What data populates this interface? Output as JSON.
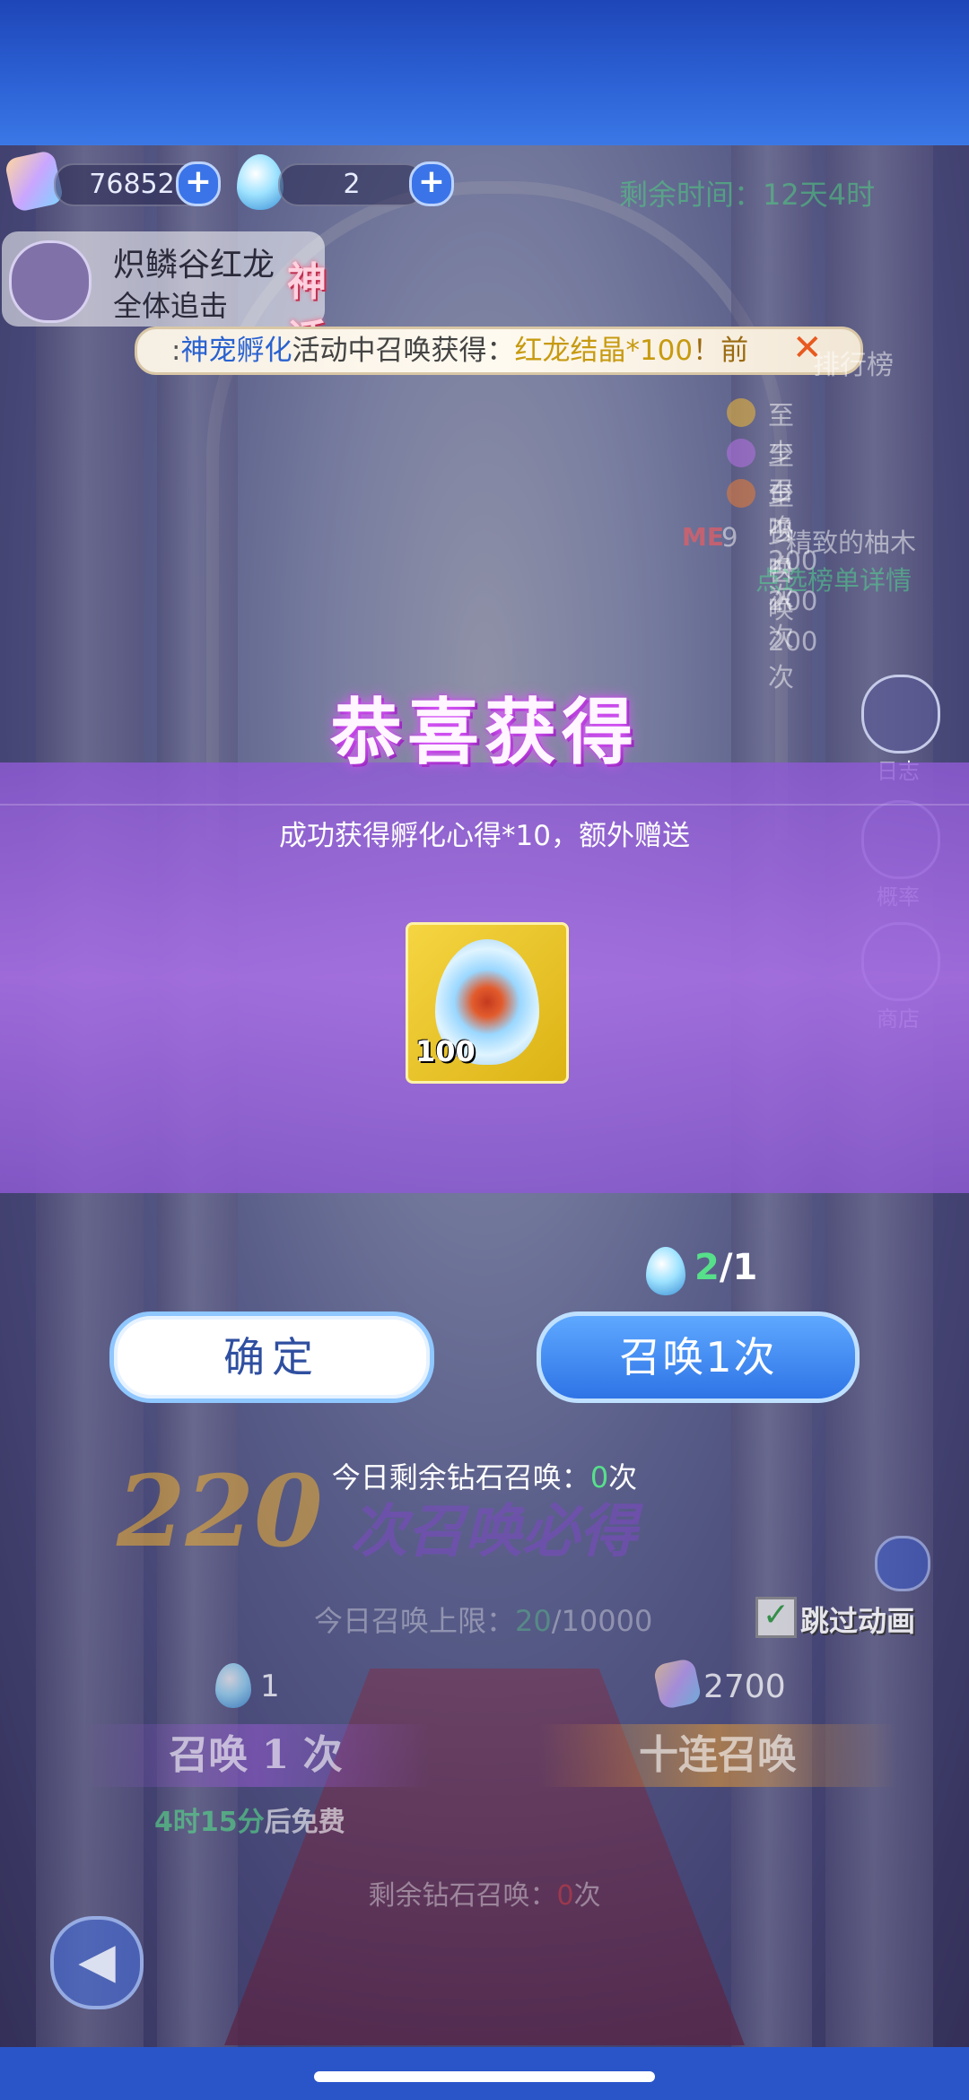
{
  "currency": {
    "gems": "76852",
    "eggs": "2",
    "plus": "+"
  },
  "event": {
    "remaining_time": "剩余时间：12天4时"
  },
  "boss": {
    "name": "炽鳞谷红龙",
    "subtitle": "全体追击",
    "badge": "神话"
  },
  "marquee": {
    "prefix": ":",
    "activity": "神宠孵化",
    "middle": "活动中召唤获得：",
    "item": "红龙结晶*100",
    "suffix": "！前"
  },
  "ranking": {
    "title": "排行榜",
    "entries": [
      {
        "rank": "1",
        "text": "至少召唤200次",
        "color": "#e8b43a"
      },
      {
        "rank": "2",
        "text": "至少召唤200次",
        "color": "#b070e0"
      },
      {
        "rank": "3",
        "text": "至少召唤200次",
        "color": "#e07a3a"
      }
    ],
    "me_label": "ME",
    "me_rank": "9",
    "me_name": "精致的柚木",
    "view_link": "点选榜单详情"
  },
  "side_menu": [
    {
      "label": "日志",
      "icon": "log-book-icon"
    },
    {
      "label": "概率",
      "icon": "dice-icon"
    },
    {
      "label": "商店",
      "icon": "shop-icon"
    }
  ],
  "reward_popup": {
    "title": "恭喜获得",
    "message": "成功获得孵化心得*10，额外赠送",
    "item_count": "100",
    "confirm_label": "确定",
    "summon_label": "召唤1次",
    "cost_owned": "2",
    "cost_required": "/1",
    "daily_prefix": "今日剩余钻石召唤：",
    "daily_count": "0",
    "daily_suffix": "次"
  },
  "background_page": {
    "guarantee_number": "220",
    "guarantee_text": "次召唤必得",
    "daily_limit_label": "今日召唤上限：",
    "daily_limit_used": "20",
    "daily_limit_total": "/10000",
    "skip_animation": "跳过动画",
    "single_cost": "1",
    "ten_cost": "2700",
    "single_summon": "召唤 1 次",
    "ten_summon": "十连召唤",
    "free_timer": "4时15分",
    "free_suffix": "后免费",
    "remaining_prefix": "剩余钻石召唤：",
    "remaining_count": "0",
    "remaining_suffix": "次"
  },
  "colors": {
    "accent_blue": "#2f74e6",
    "panel_purple": "#a56ee1",
    "title_glow": "#e05cff",
    "highlight_green": "#57e08a"
  }
}
